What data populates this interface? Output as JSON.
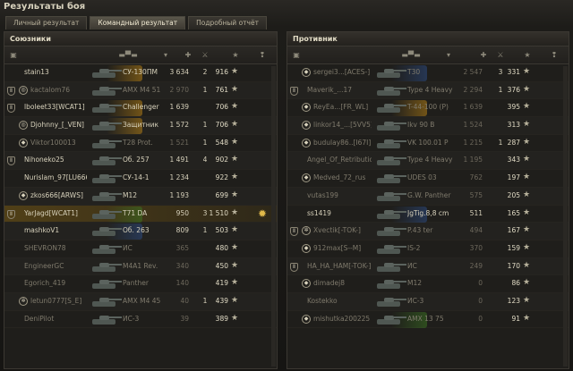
{
  "window": {
    "title": "Результаты боя"
  },
  "tabs": [
    {
      "label": "Личный результат",
      "active": false
    },
    {
      "label": "Командный результат",
      "active": true
    },
    {
      "label": "Подробный отчёт",
      "active": false
    }
  ],
  "allies": {
    "title": "Союзники",
    "header_icons": [
      "badge-icon",
      "tank-icon",
      "damage-icon",
      "kills-icon",
      "xp-star-icon",
      "medal-icon"
    ],
    "rows": [
      {
        "badge": "",
        "clan": "",
        "player": "stain13",
        "vehicle": "СУ-130ПМ",
        "damage": "3 634",
        "kills": "2",
        "xp": "916",
        "medal": "",
        "dead": false,
        "highlight": "gold",
        "player_row": false
      },
      {
        "badge": "Ⅱ",
        "clan": "◎",
        "player": "kactalom76",
        "vehicle": "AMX M4 51",
        "damage": "2 970",
        "kills": "1",
        "xp": "761",
        "medal": "",
        "dead": true,
        "highlight": "",
        "player_row": false
      },
      {
        "badge": "Ⅱ",
        "clan": "",
        "player": "lboleet33[WCAT1]",
        "vehicle": "Challenger",
        "damage": "1 639",
        "kills": "",
        "xp": "706",
        "medal": "",
        "dead": false,
        "highlight": "gold",
        "player_row": false
      },
      {
        "badge": "",
        "clan": "◎",
        "player": "Djohnny_[_VEN]",
        "vehicle": "Защитник",
        "damage": "1 572",
        "kills": "1",
        "xp": "706",
        "medal": "",
        "dead": false,
        "highlight": "gold",
        "player_row": false
      },
      {
        "badge": "",
        "clan": "◆",
        "player": "Viktor100013",
        "vehicle": "T28 Prot.",
        "damage": "1 521",
        "kills": "1",
        "xp": "548",
        "medal": "",
        "dead": true,
        "highlight": "",
        "player_row": false
      },
      {
        "badge": "Ⅱ",
        "clan": "",
        "player": "Nihoneko25",
        "vehicle": "Об. 257",
        "damage": "1 491",
        "kills": "4",
        "xp": "902",
        "medal": "",
        "dead": false,
        "highlight": "",
        "player_row": false
      },
      {
        "badge": "",
        "clan": "",
        "player": "Nurislam_97[LU666]",
        "vehicle": "СУ-14-1",
        "damage": "1 234",
        "kills": "",
        "xp": "922",
        "medal": "",
        "dead": false,
        "highlight": "",
        "player_row": false
      },
      {
        "badge": "",
        "clan": "◆",
        "player": "zkos666[ARWS]",
        "vehicle": "M12",
        "damage": "1 193",
        "kills": "",
        "xp": "699",
        "medal": "",
        "dead": false,
        "highlight": "",
        "player_row": false
      },
      {
        "badge": "Ⅱ",
        "clan": "",
        "player": "YarJagd[WCAT1]",
        "vehicle": "T71 DA",
        "damage": "950",
        "kills": "3",
        "xp": "1 510",
        "medal": "✹",
        "dead": false,
        "highlight": "green",
        "player_row": true
      },
      {
        "badge": "",
        "clan": "",
        "player": "mashkoV1",
        "vehicle": "Об. 263",
        "damage": "809",
        "kills": "1",
        "xp": "503",
        "medal": "",
        "dead": false,
        "highlight": "blue",
        "player_row": false
      },
      {
        "badge": "",
        "clan": "",
        "player": "SHEVRON78",
        "vehicle": "ИС",
        "damage": "365",
        "kills": "",
        "xp": "480",
        "medal": "",
        "dead": true,
        "highlight": "",
        "player_row": false
      },
      {
        "badge": "",
        "clan": "",
        "player": "EngineerGC",
        "vehicle": "M4A1 Rev.",
        "damage": "340",
        "kills": "",
        "xp": "450",
        "medal": "",
        "dead": true,
        "highlight": "",
        "player_row": false
      },
      {
        "badge": "",
        "clan": "",
        "player": "Egorich_419",
        "vehicle": "Panther",
        "damage": "140",
        "kills": "",
        "xp": "419",
        "medal": "",
        "dead": true,
        "highlight": "",
        "player_row": false
      },
      {
        "badge": "",
        "clan": "✲",
        "player": "letun0777[S_E]",
        "vehicle": "AMX M4 45",
        "damage": "40",
        "kills": "1",
        "xp": "439",
        "medal": "",
        "dead": true,
        "highlight": "",
        "player_row": false
      },
      {
        "badge": "",
        "clan": "",
        "player": "DeniPilot",
        "vehicle": "ИС-3",
        "damage": "39",
        "kills": "",
        "xp": "389",
        "medal": "",
        "dead": true,
        "highlight": "",
        "player_row": false
      }
    ]
  },
  "enemies": {
    "title": "Противник",
    "header_icons": [
      "badge-icon",
      "tank-icon",
      "damage-icon",
      "kills-icon",
      "xp-star-icon",
      "medal-icon"
    ],
    "rows": [
      {
        "badge": "",
        "clan": "◆",
        "player": "sergei3...[ACES-]",
        "vehicle": "T30",
        "damage": "2 547",
        "kills": "3",
        "xp": "331",
        "dead": true,
        "highlight": "blue"
      },
      {
        "badge": "Ⅱ",
        "clan": "",
        "player": "Maverik_...17",
        "vehicle": "Type 4 Heavy",
        "damage": "2 294",
        "kills": "1",
        "xp": "376",
        "dead": true,
        "highlight": ""
      },
      {
        "badge": "",
        "clan": "◆",
        "player": "ReyEa...[FR_WL]",
        "vehicle": "T-44-100 (P)",
        "damage": "1 639",
        "kills": "",
        "xp": "395",
        "dead": true,
        "highlight": "gold"
      },
      {
        "badge": "",
        "clan": "◆",
        "player": "linkor14_...[5VV5]",
        "vehicle": "Ikv 90 B",
        "damage": "1 524",
        "kills": "",
        "xp": "313",
        "dead": true,
        "highlight": ""
      },
      {
        "badge": "",
        "clan": "◆",
        "player": "budulay86..[I67I]",
        "vehicle": "VK 100.01 P",
        "damage": "1 215",
        "kills": "1",
        "xp": "287",
        "dead": true,
        "highlight": ""
      },
      {
        "badge": "",
        "clan": "",
        "player": "Angel_Of_Retribution",
        "vehicle": "Type 4 Heavy",
        "damage": "1 195",
        "kills": "",
        "xp": "343",
        "dead": true,
        "highlight": ""
      },
      {
        "badge": "",
        "clan": "◆",
        "player": "Medved_72_rus",
        "vehicle": "UDES 03",
        "damage": "762",
        "kills": "",
        "xp": "197",
        "dead": true,
        "highlight": ""
      },
      {
        "badge": "",
        "clan": "",
        "player": "vutas199",
        "vehicle": "G.W. Panther",
        "damage": "575",
        "kills": "",
        "xp": "205",
        "dead": true,
        "highlight": ""
      },
      {
        "badge": "",
        "clan": "",
        "player": "ss1419",
        "vehicle": "JgTig.8,8 cm",
        "damage": "511",
        "kills": "",
        "xp": "165",
        "dead": false,
        "highlight": "blue"
      },
      {
        "badge": "Ⅱ",
        "clan": "✲",
        "player": "Xvectik[-TOK-]",
        "vehicle": "P.43 ter",
        "damage": "494",
        "kills": "",
        "xp": "167",
        "dead": true,
        "highlight": ""
      },
      {
        "badge": "",
        "clan": "◆",
        "player": "912max[S--M]",
        "vehicle": "IS-2",
        "damage": "370",
        "kills": "",
        "xp": "159",
        "dead": true,
        "highlight": ""
      },
      {
        "badge": "Ⅱ",
        "clan": "",
        "player": "HA_HA_HAM[-TOK-]",
        "vehicle": "ИС",
        "damage": "249",
        "kills": "",
        "xp": "170",
        "dead": true,
        "highlight": ""
      },
      {
        "badge": "",
        "clan": "◆",
        "player": "dimadej8",
        "vehicle": "M12",
        "damage": "0",
        "kills": "",
        "xp": "86",
        "dead": true,
        "highlight": ""
      },
      {
        "badge": "",
        "clan": "",
        "player": "Kostekko",
        "vehicle": "ИС-3",
        "damage": "0",
        "kills": "",
        "xp": "123",
        "dead": true,
        "highlight": ""
      },
      {
        "badge": "",
        "clan": "◆",
        "player": "mishutka200225",
        "vehicle": "AMX 13 75",
        "damage": "0",
        "kills": "",
        "xp": "91",
        "dead": true,
        "highlight": "green"
      }
    ]
  },
  "colors": {
    "gold": "#c58a14",
    "blue": "#2d4f8c",
    "green": "#3d7a22"
  }
}
